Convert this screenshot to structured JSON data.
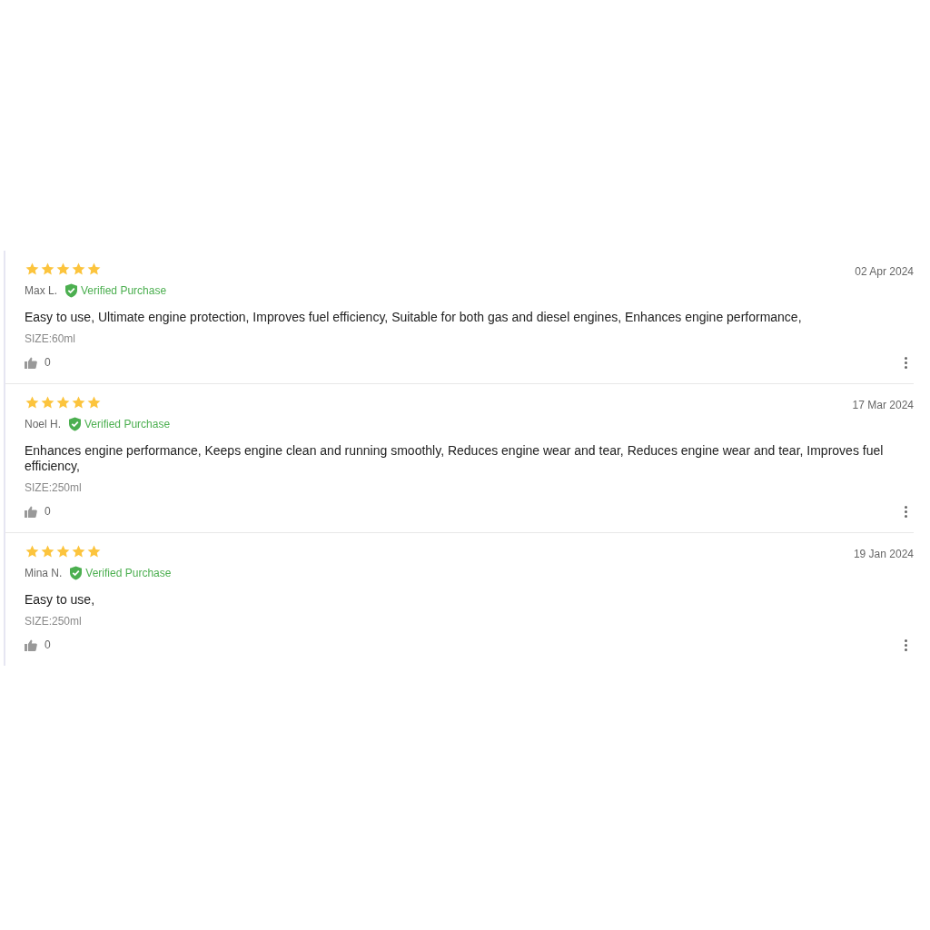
{
  "reviews": [
    {
      "stars": 5,
      "author": "Max L.",
      "badge": "Verified Purchase",
      "date": "02 Apr 2024",
      "text": "Easy to use, Ultimate engine protection, Improves fuel efficiency, Suitable for both gas and diesel engines, Enhances engine performance,",
      "size": "SIZE:60ml",
      "likes": "0"
    },
    {
      "stars": 5,
      "author": "Noel H.",
      "badge": "Verified Purchase",
      "date": "17 Mar 2024",
      "text": "Enhances engine performance, Keeps engine clean and running smoothly, Reduces engine wear and tear, Reduces engine wear and tear, Improves fuel efficiency,",
      "size": "SIZE:250ml",
      "likes": "0"
    },
    {
      "stars": 5,
      "author": "Mina N.",
      "badge": "Verified Purchase",
      "date": "19 Jan 2024",
      "text": "Easy to use,",
      "size": "SIZE:250ml",
      "likes": "0"
    }
  ]
}
